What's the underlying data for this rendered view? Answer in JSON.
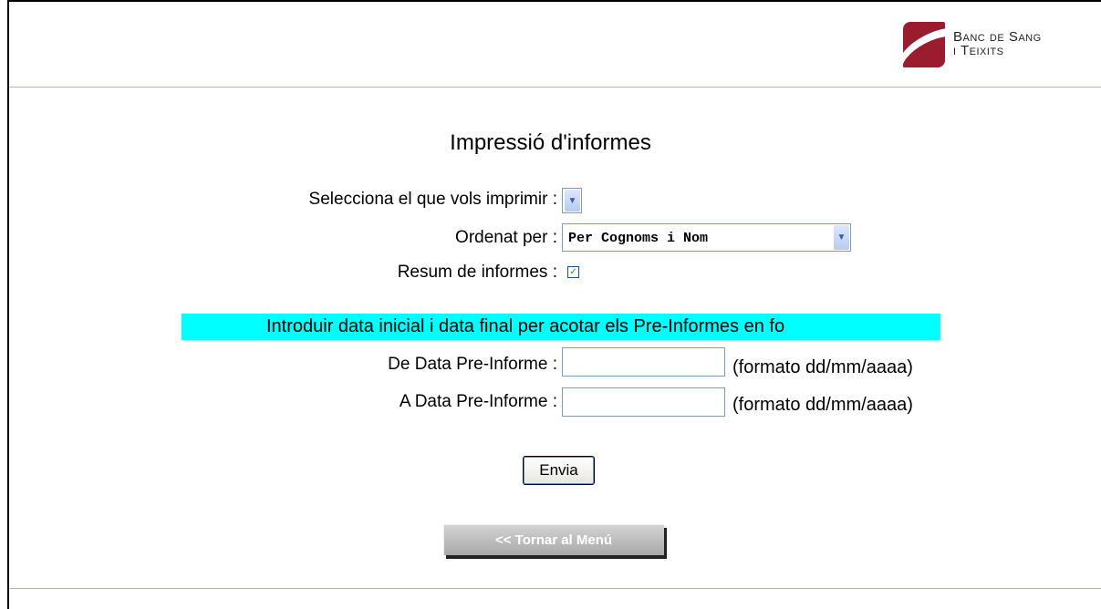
{
  "logo": {
    "line1": "Banc de Sang",
    "line2": "i Teixits"
  },
  "page_title": "Impressió d'informes",
  "form": {
    "select_report_label": "Selecciona el que vols imprimir :",
    "select_report_value": "",
    "order_label": "Ordenat per :",
    "order_value": "Per Cognoms i Nom",
    "summary_label": "Resum de informes :",
    "summary_checked": true,
    "banner_text": "Introduir data inicial i data final per acotar els Pre-Informes en fo",
    "from_date_label": "De Data Pre-Informe :",
    "from_date_value": "",
    "from_date_hint": "(formato dd/mm/aaaa)",
    "to_date_label": "A Data Pre-Informe :",
    "to_date_value": "",
    "to_date_hint": "(formato dd/mm/aaaa)",
    "submit_label": "Envia"
  },
  "back_button": {
    "label": "<< Tornar al Menú"
  },
  "icons": {
    "dropdown": "chevron-down-icon",
    "checkbox": "check-icon"
  },
  "colors": {
    "brand": "#9b1c2e",
    "banner": "#00ffff",
    "rule": "#b8b8a0"
  }
}
